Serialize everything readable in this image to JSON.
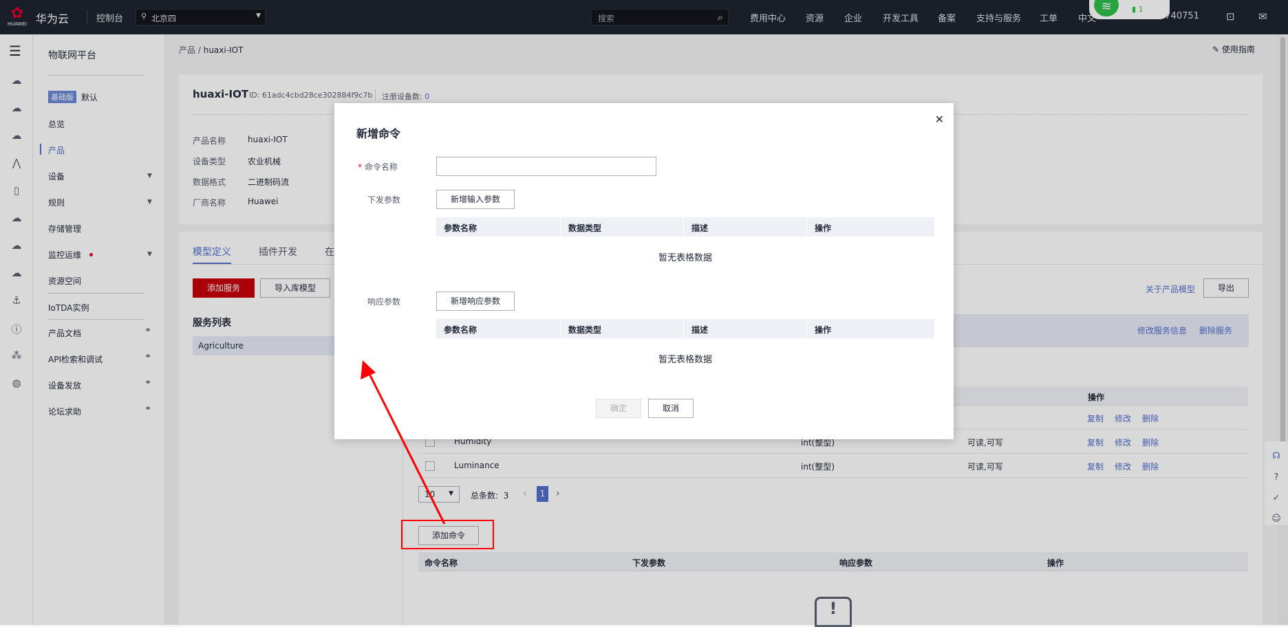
{
  "topbar": {
    "logo_glyph": "✿",
    "logo_text": "HUAWEI",
    "brand": "华为云",
    "console": "控制台",
    "region": "北京四",
    "search_placeholder": "搜索",
    "nav": [
      "费用中心",
      "资源",
      "企业",
      "开发工具",
      "备案",
      "支持与服务",
      "工单",
      "中文"
    ],
    "account_fragment": "4740751",
    "wifi_count": "1"
  },
  "sidebar": {
    "title": "物联网平台",
    "edition_badge": "基础版",
    "edition_name": "默认",
    "items": [
      {
        "label": "总览"
      },
      {
        "label": "产品",
        "active": true
      },
      {
        "label": "设备",
        "expandable": true
      },
      {
        "label": "规则",
        "expandable": true
      },
      {
        "label": "存储管理"
      },
      {
        "label": "监控运维",
        "expandable": true,
        "dot": true
      },
      {
        "label": "资源空间"
      },
      {
        "label": "IoTDA实例"
      },
      {
        "label": "产品文档",
        "external": true
      },
      {
        "label": "API检索和调试",
        "external": true
      },
      {
        "label": "设备发放",
        "external": true
      },
      {
        "label": "论坛求助",
        "external": true
      }
    ]
  },
  "breadcrumb": {
    "root": "产品",
    "separator": "/",
    "current": "huaxi-IOT"
  },
  "guide_label": "使用指南",
  "product": {
    "name": "huaxi-IOT",
    "id_text": "ID: 61adc4cbd28ce302884f9c7b",
    "registered_label": "注册设备数:",
    "registered_count": "0",
    "fields": [
      {
        "key": "产品名称",
        "value": "huaxi-IOT"
      },
      {
        "key": "设备类型",
        "value": "农业机械"
      },
      {
        "key": "数据格式",
        "value": "二进制码流"
      },
      {
        "key": "厂商名称",
        "value": "Huawei"
      }
    ]
  },
  "tabs": [
    "模型定义",
    "插件开发",
    "在"
  ],
  "actions": {
    "add_service": "添加服务",
    "import_model": "导入库模型",
    "about_model": "关于产品模型",
    "export": "导出"
  },
  "service_list": {
    "title": "服务列表",
    "items": [
      "Agriculture"
    ]
  },
  "service_links": {
    "edit": "修改服务信息",
    "delete": "删除服务"
  },
  "property_table": {
    "op_header": "操作",
    "rows": [
      {
        "name": "Humidity",
        "type": "int(整型)",
        "access": "可读,可写"
      },
      {
        "name": "Luminance",
        "type": "int(整型)",
        "access": "可读,可写"
      }
    ],
    "row_ops": [
      "复制",
      "修改",
      "删除"
    ]
  },
  "pagination": {
    "page_size": "10",
    "total_label": "总条数:",
    "total": "3",
    "prev": "‹",
    "current": "1",
    "next": "›"
  },
  "command": {
    "add_button": "添加命令",
    "headers": [
      "命令名称",
      "下发参数",
      "响应参数",
      "操作"
    ]
  },
  "modal": {
    "title": "新增命令",
    "name_label": "命令名称",
    "name_value": "",
    "down_label": "下发参数",
    "add_input_param": "新增输入参数",
    "resp_label": "响应参数",
    "add_resp_param": "新增响应参数",
    "table_headers": [
      "参数名称",
      "数据类型",
      "描述",
      "操作"
    ],
    "empty_text": "暂无表格数据",
    "ok": "确定",
    "cancel": "取消"
  },
  "colors": {
    "accent": "#526ecc",
    "brand_red": "#c7000b",
    "annotation_red": "#ff0000"
  }
}
